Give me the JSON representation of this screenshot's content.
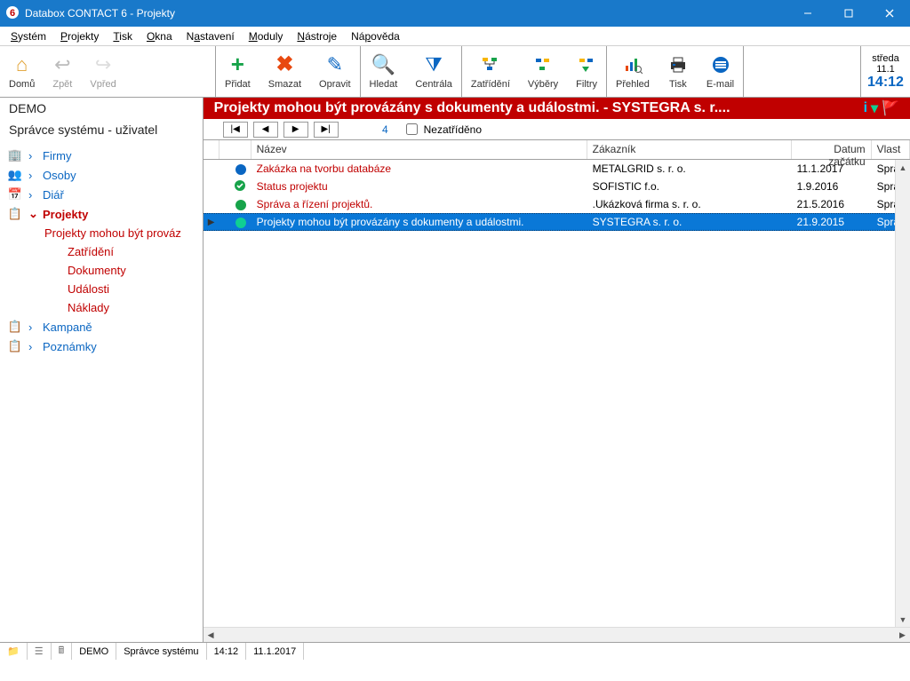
{
  "window": {
    "title": "Databox CONTACT 6 - Projekty"
  },
  "menus": [
    "Systém",
    "Projekty",
    "Tisk",
    "Okna",
    "Nastavení",
    "Moduly",
    "Nástroje",
    "Nápověda"
  ],
  "toolbar": {
    "home": "Domů",
    "back": "Zpět",
    "forward": "Vpřed",
    "add": "Přidat",
    "del": "Smazat",
    "edit": "Opravit",
    "find": "Hledat",
    "central": "Centrála",
    "classify": "Zatřídění",
    "selections": "Výběry",
    "filters": "Filtry",
    "overview": "Přehled",
    "print": "Tisk",
    "email": "E-mail",
    "day": "středa",
    "date": "11.1",
    "time": "14:12"
  },
  "banner": "Projekty mohou být provázány s dokumenty a událostmi. - SYSTEGRA s. r....",
  "sidebar": {
    "app": "DEMO",
    "user": "Správce systému - uživatel",
    "firm": "Firmy",
    "persons": "Osoby",
    "diary": "Diář",
    "projects": "Projekty",
    "project_sel": "Projekty mohou být prováz",
    "classify": "Zatřídění",
    "docs": "Dokumenty",
    "events": "Události",
    "costs": "Náklady",
    "campaigns": "Kampaně",
    "notes": "Poznámky"
  },
  "pager": {
    "count": "4",
    "unclassified": "Nezatříděno"
  },
  "columns": {
    "name": "Název",
    "customer": "Zákazník",
    "start": "Datum začátku",
    "owner": "Vlast"
  },
  "rows": [
    {
      "dot": "#0a66c2",
      "name": "Zakázka na tvorbu databáze",
      "customer": "METALGRID s. r. o.",
      "date": "11.1.2017",
      "owner": "Správ"
    },
    {
      "dot": "#17a34a",
      "check": true,
      "name": "Status projektu",
      "customer": "SOFISTIC f.o.",
      "date": "1.9.2016",
      "owner": "Správ"
    },
    {
      "dot": "#17a34a",
      "name": "Správa a řízení projektů.",
      "customer": ".Ukázková firma s. r. o.",
      "date": "21.5.2016",
      "owner": "Správ"
    },
    {
      "dot": "#0fcf92",
      "name": "Projekty mohou být provázány s dokumenty a událostmi.",
      "customer": "SYSTEGRA s. r. o.",
      "date": "21.9.2015",
      "owner": "Správ",
      "selected": true
    }
  ],
  "status": {
    "env": "DEMO",
    "user": "Správce systému",
    "time": "14:12",
    "date": "11.1.2017"
  }
}
